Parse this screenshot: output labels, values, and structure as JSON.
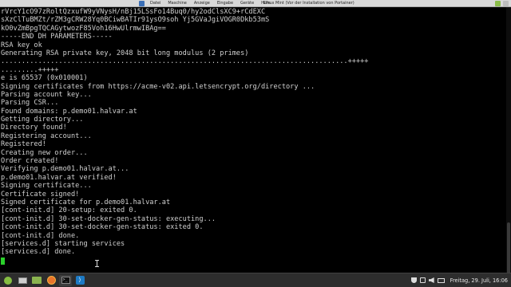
{
  "vm_window": {
    "menu": [
      "Datei",
      "Maschine",
      "Anzeige",
      "Eingabe",
      "Geräte",
      "Hilfe"
    ],
    "title": "Linux Mint (Vor der Installation von Portainer)"
  },
  "terminal": {
    "lines": [
      "rVrcY1cO97zRoltQzxufW9yVNysH/nBj15LSsFo14Buq0/hy2odClsXC9+rCdEXC",
      "sXzClTuBMZt/rZM3gCRW28Yq0BCiwBATIr91ysO9soh Yj5GVaJgiVOGR0Dkb53mS",
      "kO0vZmBpgTQCAGytwozF85Voh16HwUlrmwIBAg==",
      "-----END DH PARAMETERS-----",
      "RSA key ok",
      "Generating RSA private key, 2048 bit long modulus (2 primes)",
      "....................................................................................+++++",
      ".........+++++",
      "e is 65537 (0x010001)",
      "Signing certificates from https://acme-v02.api.letsencrypt.org/directory ...",
      "Parsing account key...",
      "Parsing CSR...",
      "Found domains: p.demo01.halvar.at",
      "Getting directory...",
      "Directory found!",
      "Registering account...",
      "Registered!",
      "Creating new order...",
      "Order created!",
      "Verifying p.demo01.halvar.at...",
      "p.demo01.halvar.at verified!",
      "Signing certificate...",
      "Certificate signed!",
      "Signed certificate for p.demo01.halvar.at",
      "[cont-init.d] 20-setup: exited 0.",
      "[cont-init.d] 30-set-docker-gen-status: executing...",
      "[cont-init.d] 30-set-docker-gen-status: exited 0.",
      "[cont-init.d] done.",
      "[services.d] starting services",
      "[services.d] done.",
      ""
    ]
  },
  "taskbar": {
    "menu_glyph": "",
    "terminal_glyph": ">_",
    "vscode_glyph": "⟩",
    "clock": "Freitag, 29. Juli, 16:06"
  },
  "colors": {
    "terminal_bg": "#000000",
    "terminal_fg": "#d0d0d0",
    "cursor": "#2bd12b",
    "taskbar": "#2d2d2d"
  }
}
